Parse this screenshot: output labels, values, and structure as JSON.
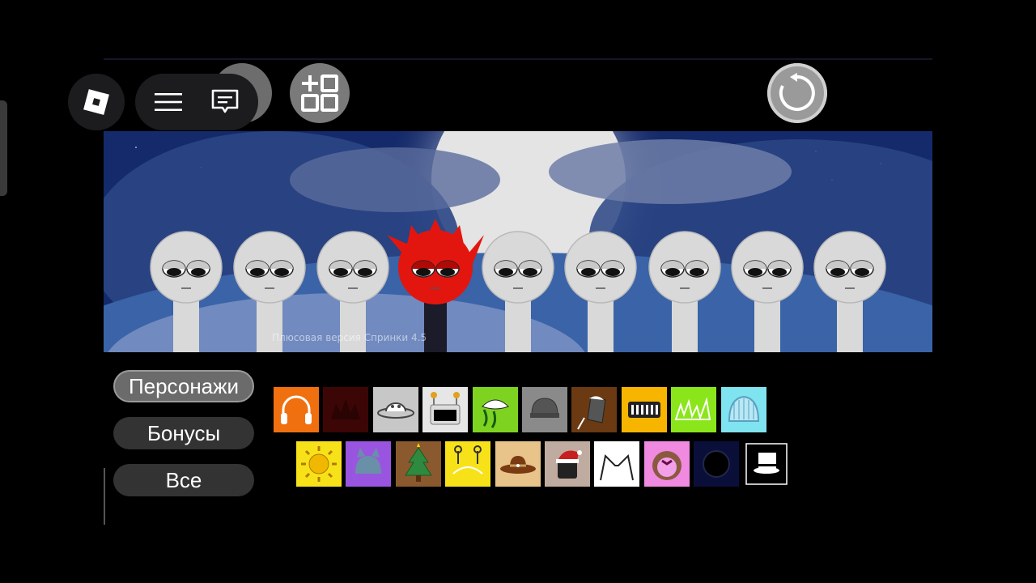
{
  "toolbar": {
    "icons": [
      "roblox-logo-icon",
      "menu-icon",
      "chat-icon",
      "add-grid-icon",
      "reset-icon"
    ]
  },
  "stage": {
    "watermark": "Плюсовая версия Спринки 4.5",
    "characters": [
      {
        "name": "gray-sprunki",
        "color": "#d9d9d9"
      },
      {
        "name": "gray-sprunki",
        "color": "#d9d9d9"
      },
      {
        "name": "gray-sprunki",
        "color": "#d9d9d9"
      },
      {
        "name": "red-spiky-sprunki",
        "color": "#e3160f"
      },
      {
        "name": "gray-sprunki",
        "color": "#d9d9d9"
      },
      {
        "name": "gray-sprunki",
        "color": "#d9d9d9"
      },
      {
        "name": "gray-sprunki",
        "color": "#d9d9d9"
      },
      {
        "name": "gray-sprunki",
        "color": "#d9d9d9"
      },
      {
        "name": "gray-sprunki",
        "color": "#d9d9d9"
      }
    ]
  },
  "categories": {
    "characters": "Персонажи",
    "bonuses": "Бонусы",
    "all": "Все",
    "active": "characters"
  },
  "tiles_row1": [
    {
      "icon": "headphones-icon",
      "bg": "#f07010"
    },
    {
      "icon": "spiky-hair-icon",
      "bg": "#3d0606"
    },
    {
      "icon": "ufo-icon",
      "bg": "#c7c7c7"
    },
    {
      "icon": "robot-antenna-icon",
      "bg": "#e6e6e6"
    },
    {
      "icon": "leaf-hat-icon",
      "bg": "#7ed321"
    },
    {
      "icon": "gray-beanie-icon",
      "bg": "#8a8a8a"
    },
    {
      "icon": "top-hat-icon",
      "bg": "#6b3a12"
    },
    {
      "icon": "keyboard-icon",
      "bg": "#f7b500"
    },
    {
      "icon": "grass-icon",
      "bg": "#8ae61a"
    },
    {
      "icon": "knit-hat-icon",
      "bg": "#7fe3f0"
    }
  ],
  "tiles_row2": [
    {
      "icon": "sun-icon",
      "bg": "#f7e21a"
    },
    {
      "icon": "cat-ear-hat-icon",
      "bg": "#9a55e0"
    },
    {
      "icon": "christmas-tree-icon",
      "bg": "#8a5a2e"
    },
    {
      "icon": "antenna-icon",
      "bg": "#f7e21a"
    },
    {
      "icon": "cowboy-hat-icon",
      "bg": "#e8c48a"
    },
    {
      "icon": "santa-hat-icon",
      "bg": "#c0aba0"
    },
    {
      "icon": "cat-ears-icon",
      "bg": "#ffffff"
    },
    {
      "icon": "curly-hair-icon",
      "bg": "#f08ae0"
    },
    {
      "icon": "dark-orb-icon",
      "bg": "#0a0f3a"
    },
    {
      "icon": "white-top-hat-icon",
      "bg": "#000000"
    }
  ]
}
